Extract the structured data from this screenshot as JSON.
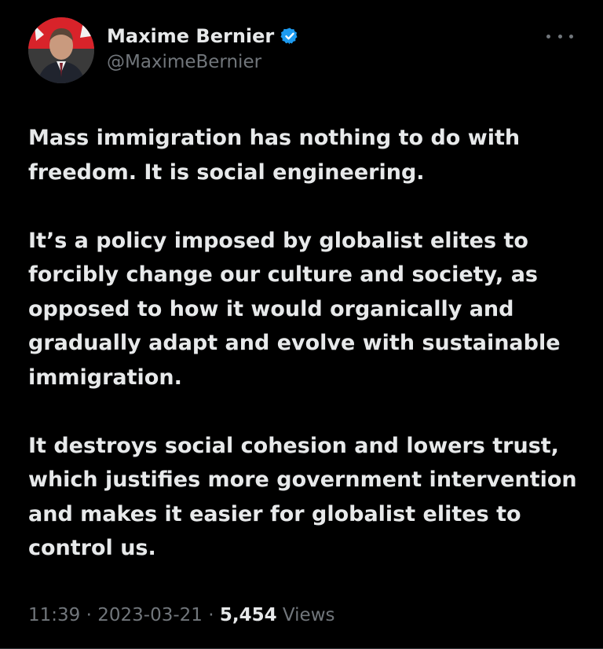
{
  "author": {
    "display_name": "Maxime Bernier",
    "handle": "@MaximeBernier",
    "verified": true,
    "avatar_icon": "profile-photo"
  },
  "tweet": {
    "paragraphs": [
      "Mass immigration has nothing to do with freedom. It is social engineering.",
      "It’s a policy imposed by globalist elites to forcibly change our culture and society, as opposed to how it would organically and gradually adapt and evolve with sustainable immigration.",
      "It destroys social cohesion and lowers trust, which justifies more government intervention and makes it easier for globalist elites to control us."
    ]
  },
  "meta": {
    "time": "11:39",
    "separator": " · ",
    "date": "2023-03-21",
    "views_count": "5,454",
    "views_label": "Views"
  },
  "colors": {
    "background": "#000000",
    "text": "#e7e9ea",
    "muted": "#71767b",
    "verified": "#1d9bf0"
  },
  "icons": {
    "verified": "verified-badge-icon",
    "more": "more-options-icon"
  }
}
